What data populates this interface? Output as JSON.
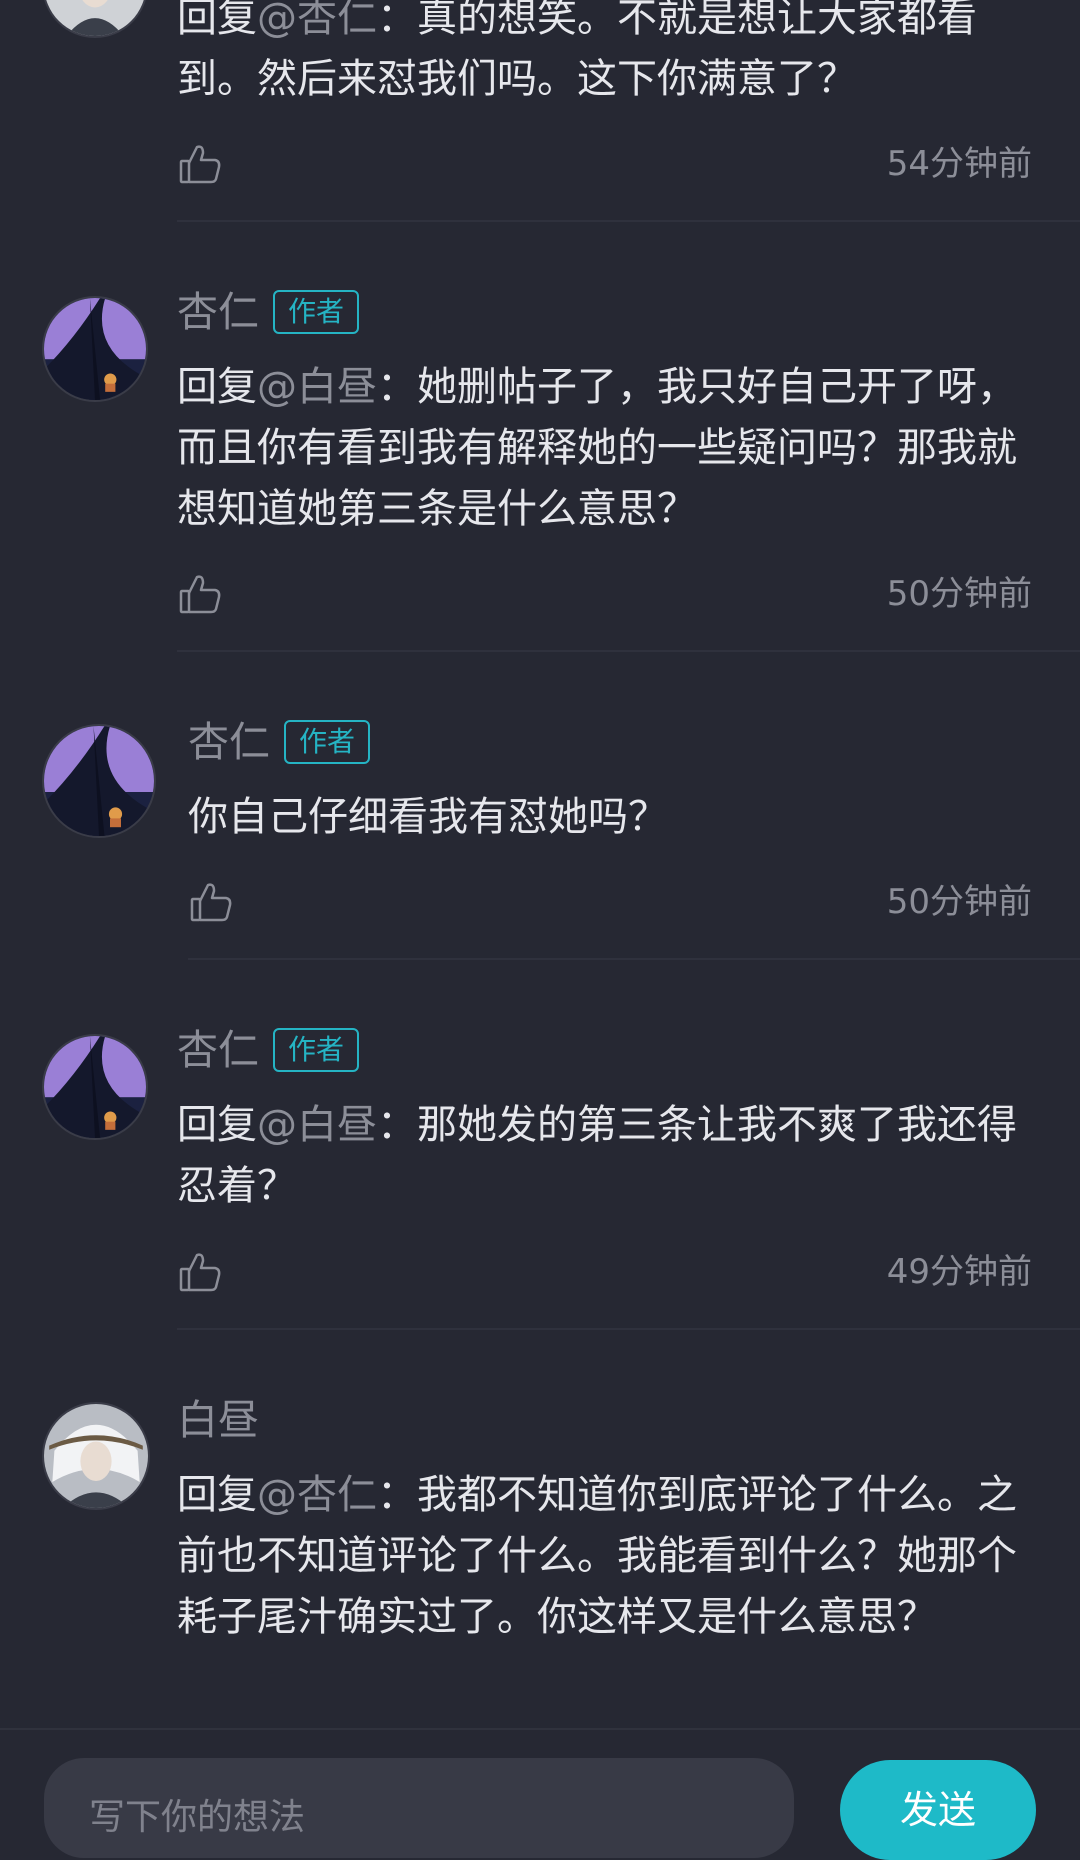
{
  "colors": {
    "background": "#262833",
    "accent": "#1ebac8",
    "muted_text": "#8c8e98",
    "primary_text": "#e6e7ec"
  },
  "comments": [
    {
      "author": "",
      "mention": "@杏仁",
      "reply_prefix": "回复",
      "text": "：真的想笑。不就是想让大家都看到。然后来怼我们吗。这下你满意了？",
      "time": "54分钟前",
      "avatar": "white-hair-avatar"
    },
    {
      "author": "杏仁",
      "badge": "作者",
      "mention": "@白昼",
      "reply_prefix": "回复",
      "text": "：她删帖子了，我只好自己开了呀，而且你有看到我有解释她的一些疑问吗？那我就想知道她第三条是什么意思？",
      "time": "50分钟前",
      "avatar": "purple-tree-avatar"
    },
    {
      "author": "杏仁",
      "badge": "作者",
      "text": "你自己仔细看我有怼她吗？",
      "time": "50分钟前",
      "avatar": "purple-tree-avatar"
    },
    {
      "author": "杏仁",
      "badge": "作者",
      "mention": "@白昼",
      "reply_prefix": "回复",
      "text": "：那她发的第三条让我不爽了我还得忍着？",
      "time": "49分钟前",
      "avatar": "purple-tree-avatar"
    },
    {
      "author": "白昼",
      "mention": "@杏仁",
      "reply_prefix": "回复",
      "text": "：我都不知道你到底评论了什么。之前也不知道评论了什么。我能看到什么？她那个耗子尾汁确实过了。你这样又是什么意思？",
      "avatar": "white-hair-avatar"
    }
  ],
  "composer": {
    "placeholder": "写下你的想法",
    "send_label": "发送"
  }
}
